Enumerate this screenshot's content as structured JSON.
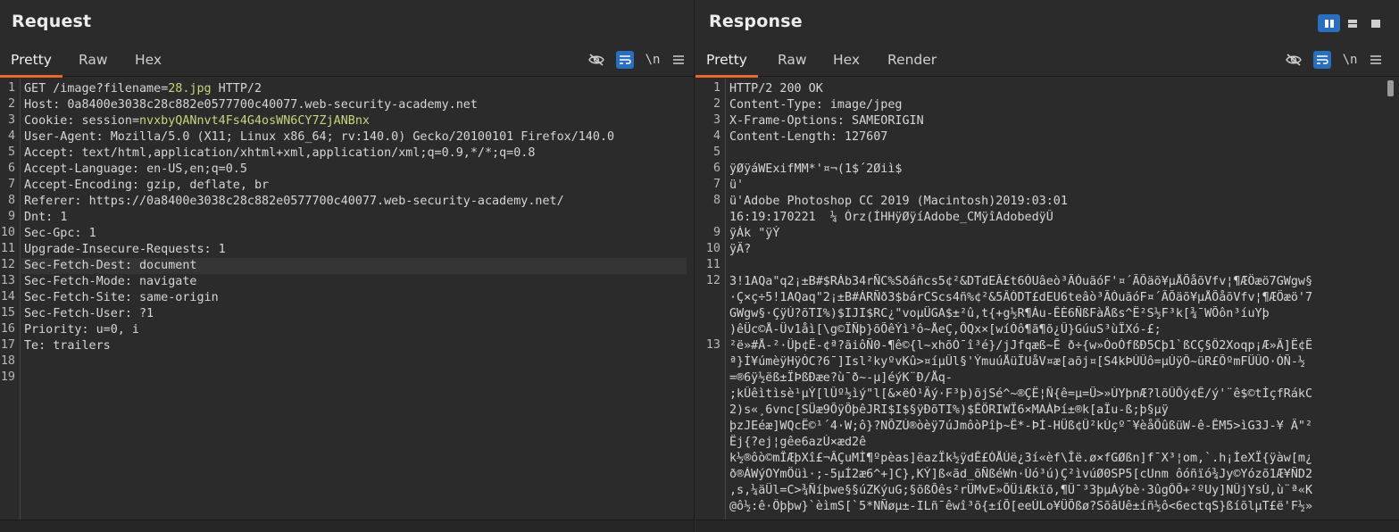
{
  "request": {
    "title": "Request",
    "tabs": [
      "Pretty",
      "Raw",
      "Hex"
    ],
    "active_tab": "Pretty",
    "newline_label": "\\n",
    "lines": [
      {
        "n": "1",
        "parts": [
          [
            "GET /image?",
            "hk"
          ],
          [
            "filename",
            "hk"
          ],
          [
            "=",
            "hk"
          ],
          [
            "28.jpg",
            "hlv"
          ],
          [
            " HTTP/2",
            "hk"
          ]
        ]
      },
      {
        "n": "2",
        "parts": [
          [
            "Host: ",
            "hk"
          ],
          [
            "0a8400e3038c28c882e0577700c40077.web-security-academy.net",
            "hv"
          ]
        ]
      },
      {
        "n": "3",
        "parts": [
          [
            "Cookie: ",
            "hk"
          ],
          [
            "session",
            "hk"
          ],
          [
            "=",
            "hk"
          ],
          [
            "nvxbyQANnvt4Fs4G4osWN6CY7ZjANBnx",
            "hlv"
          ]
        ]
      },
      {
        "n": "4",
        "parts": [
          [
            "User-Agent: ",
            "hk"
          ],
          [
            "Mozilla/5.0 (X11; Linux x86_64; rv:140.0) Gecko/20100101 Firefox/140.0",
            "hv"
          ]
        ]
      },
      {
        "n": "5",
        "parts": [
          [
            "Accept: ",
            "hk"
          ],
          [
            "text/html,application/xhtml+xml,application/xml;q=0.9,*/*;q=0.8",
            "hv"
          ]
        ]
      },
      {
        "n": "6",
        "parts": [
          [
            "Accept-Language: ",
            "hk"
          ],
          [
            "en-US,en;q=0.5",
            "hv"
          ]
        ]
      },
      {
        "n": "7",
        "parts": [
          [
            "Accept-Encoding: ",
            "hk"
          ],
          [
            "gzip, deflate, br",
            "hv"
          ]
        ]
      },
      {
        "n": "8",
        "parts": [
          [
            "Referer: ",
            "hk"
          ],
          [
            "https://0a8400e3038c28c882e0577700c40077.web-security-academy.net/",
            "hv"
          ]
        ]
      },
      {
        "n": "9",
        "parts": [
          [
            "Dnt: ",
            "hk"
          ],
          [
            "1",
            "hv"
          ]
        ]
      },
      {
        "n": "10",
        "parts": [
          [
            "Sec-Gpc: ",
            "hk"
          ],
          [
            "1",
            "hv"
          ]
        ]
      },
      {
        "n": "11",
        "parts": [
          [
            "Upgrade-Insecure-Requests: ",
            "hk"
          ],
          [
            "1",
            "hv"
          ]
        ]
      },
      {
        "n": "12",
        "parts": [
          [
            "Sec-Fetch-Dest: ",
            "hk"
          ],
          [
            "document",
            "hv"
          ]
        ],
        "highlight": true
      },
      {
        "n": "13",
        "parts": [
          [
            "Sec-Fetch-Mode: ",
            "hk"
          ],
          [
            "navigate",
            "hv"
          ]
        ]
      },
      {
        "n": "14",
        "parts": [
          [
            "Sec-Fetch-Site: ",
            "hk"
          ],
          [
            "same-origin",
            "hv"
          ]
        ]
      },
      {
        "n": "15",
        "parts": [
          [
            "Sec-Fetch-User: ",
            "hk"
          ],
          [
            "?1",
            "hv"
          ]
        ]
      },
      {
        "n": "16",
        "parts": [
          [
            "Priority: ",
            "hk"
          ],
          [
            "u=0, i",
            "hv"
          ]
        ]
      },
      {
        "n": "17",
        "parts": [
          [
            "Te: ",
            "hk"
          ],
          [
            "trailers",
            "hv"
          ]
        ]
      },
      {
        "n": "18",
        "parts": []
      },
      {
        "n": "19",
        "parts": []
      }
    ]
  },
  "response": {
    "title": "Response",
    "tabs": [
      "Pretty",
      "Raw",
      "Hex",
      "Render"
    ],
    "active_tab": "Pretty",
    "newline_label": "\\n",
    "gutter_numbers": [
      {
        "n": "1",
        "row": 0
      },
      {
        "n": "2",
        "row": 1
      },
      {
        "n": "3",
        "row": 2
      },
      {
        "n": "4",
        "row": 3
      },
      {
        "n": "5",
        "row": 4
      },
      {
        "n": "6",
        "row": 5
      },
      {
        "n": "7",
        "row": 6
      },
      {
        "n": "8",
        "row": 7
      },
      {
        "n": "9",
        "row": 9
      },
      {
        "n": "10",
        "row": 10
      },
      {
        "n": "11",
        "row": 11
      },
      {
        "n": "12",
        "row": 12
      },
      {
        "n": "13",
        "row": 16
      }
    ],
    "rows": [
      "HTTP/2 200 OK",
      "Content-Type: image/jpeg",
      "X-Frame-Options: SAMEORIGIN",
      "Content-Length: 127607",
      "",
      "ÿØÿáWExifMM*'¤¬(1$´2Øiì$",
      "ü'",
      "ü'Adobe Photoshop CC 2019 (Macintosh)2019:03:01",
      "16:19:170221  ¼ Òrz(ÍHHÿØÿíAdobe_CMÿîAdobedÿÛ",
      "ÿÀk \"ÿÝ",
      "ÿÄ?",
      "",
      "3!1AQa\"q2¡±B#$RÁb34rÑC%Sðáñcs5¢²&DTdEÂ£t6ÒUâeò³ÃÓuãóF'¤´ÃÕäõ¥µÅÕåõVfv¦¶ÆÖæö7GWgw§",
      "·Ç×ç÷5!1AQaq\"2¡±B#ÁRÑð3$bárCScs4ñ%¢²&5ÂÒDT£dEU6teâò³ÃÓuãóF¤´ÃÕäõ¥µÅÕåõVfv¦¶ÆÖæö'7",
      "GWgw§·ÇÿÚ?õTI%)$IJI$RC¿\"voµÜGA$±²û,t{+g½R¶Áu-ÊÈ6ÑßFàÅßs^Ë²S½F³k[¾¯WÕôn³íuYþ",
      ")êÜc©Å-Üv1åì[\\g©ÏÑþ}õÕêÝì³ô~ÅeÇ,ÕQx×[wíÓô¶ã¶õ¿Û}GúuS³ùÏXó-£;",
      "²ë»#Å-²·Üþ¢Ë-¢ª?ãiôÑ0-¶ê©{l~xhõÒ¯î³é}/jJfqæß~Ê ð÷{w»ÓoÒfßÐ5Cþ1`ßCÇ§Ô2Xoqp¡Æ»Ä]Ë¢Ë",
      "ª}Í¥úmèÿHÿÒC?6¯]Isl²kyºvKû>¤íµÛl§'ÝmuúÅüÏUåV¤æ[aõj¤[S4kÞÚÛô=µÚÿÔ~üR£ÕºmFÜÛO·ÒÑ-½",
      "=®6ÿ½ëß±ÏÞßÐæe?ù¯ð~-µ]éýK¨Ð/Åq-",
      ";kÛêìtìsè¹µÝ[lÛº½ìý\"l[&×ëÒ¹Äý·F³þ)õjSé^~®ÇË¦Ñ{ê=µ=Ü>»ÙYþnÆ?lõÛÕý¢Ê/ý'¨ê$©tÌçfRákC",
      "2)s«¸6vnc[SÜæ9ÕÿÕþêJRI$I$§ÿÐõTI%)$ÊÖRIWÏ6×MAÀÞí±®k[aÏu-ß;þ§µÿ",
      "þzJEéæ]WQcË©¹´4·W;ô}?NÕZÚ®òèÿ7úJmôòPîþ~Ë*-ÞÍ-HÜß¢Û²kÚçº¯¥èåÕûßüW-ê-ÊM5>ìG3J-¥ Ä\"²",
      "Ëj{?ej¦gêe6azÚ×æd2ê",
      "k½®ôò©mÎÆþXî£¬ÂÇuMÌ¶ºpèas]ëazÏk½ÿdÊ£ÒÅÙë¿3í«èf\\Îë.ø×fGØßn]f¯X³¦om,`.h¡ÌeXÏ{ÿàw[m¿",
      "ð®ÁWýOYmÖüì·;-5µÍ2æ6^+]C},KÝ]ß«ãd_õÑßéWn·Úó³ú)Ç²ìvúØ0SP5[cUnm ôóñïó¾Jy©Yózõ1Æ¥ÑD2",
      ",s,¼äÜl=C>¾Ñíþwe§§úZKýuG;§õßÕês²rÜMvE»ÕÜiÆkïõ,¶Û¯³3þµÁýbè·3ûgÔÕ+²ºUy]NÛjYsÚ,ù¨ª«K",
      "@ô½:ê·Ôþþw}`èìmS[`5*NÑøµ±-ILñ¯êwî³õ{±íÕ[eeÙLo¥ÜÕßø?SõâUê±íñ½ô<6ectqS}ßíõlµT£ë'F½»"
    ]
  }
}
